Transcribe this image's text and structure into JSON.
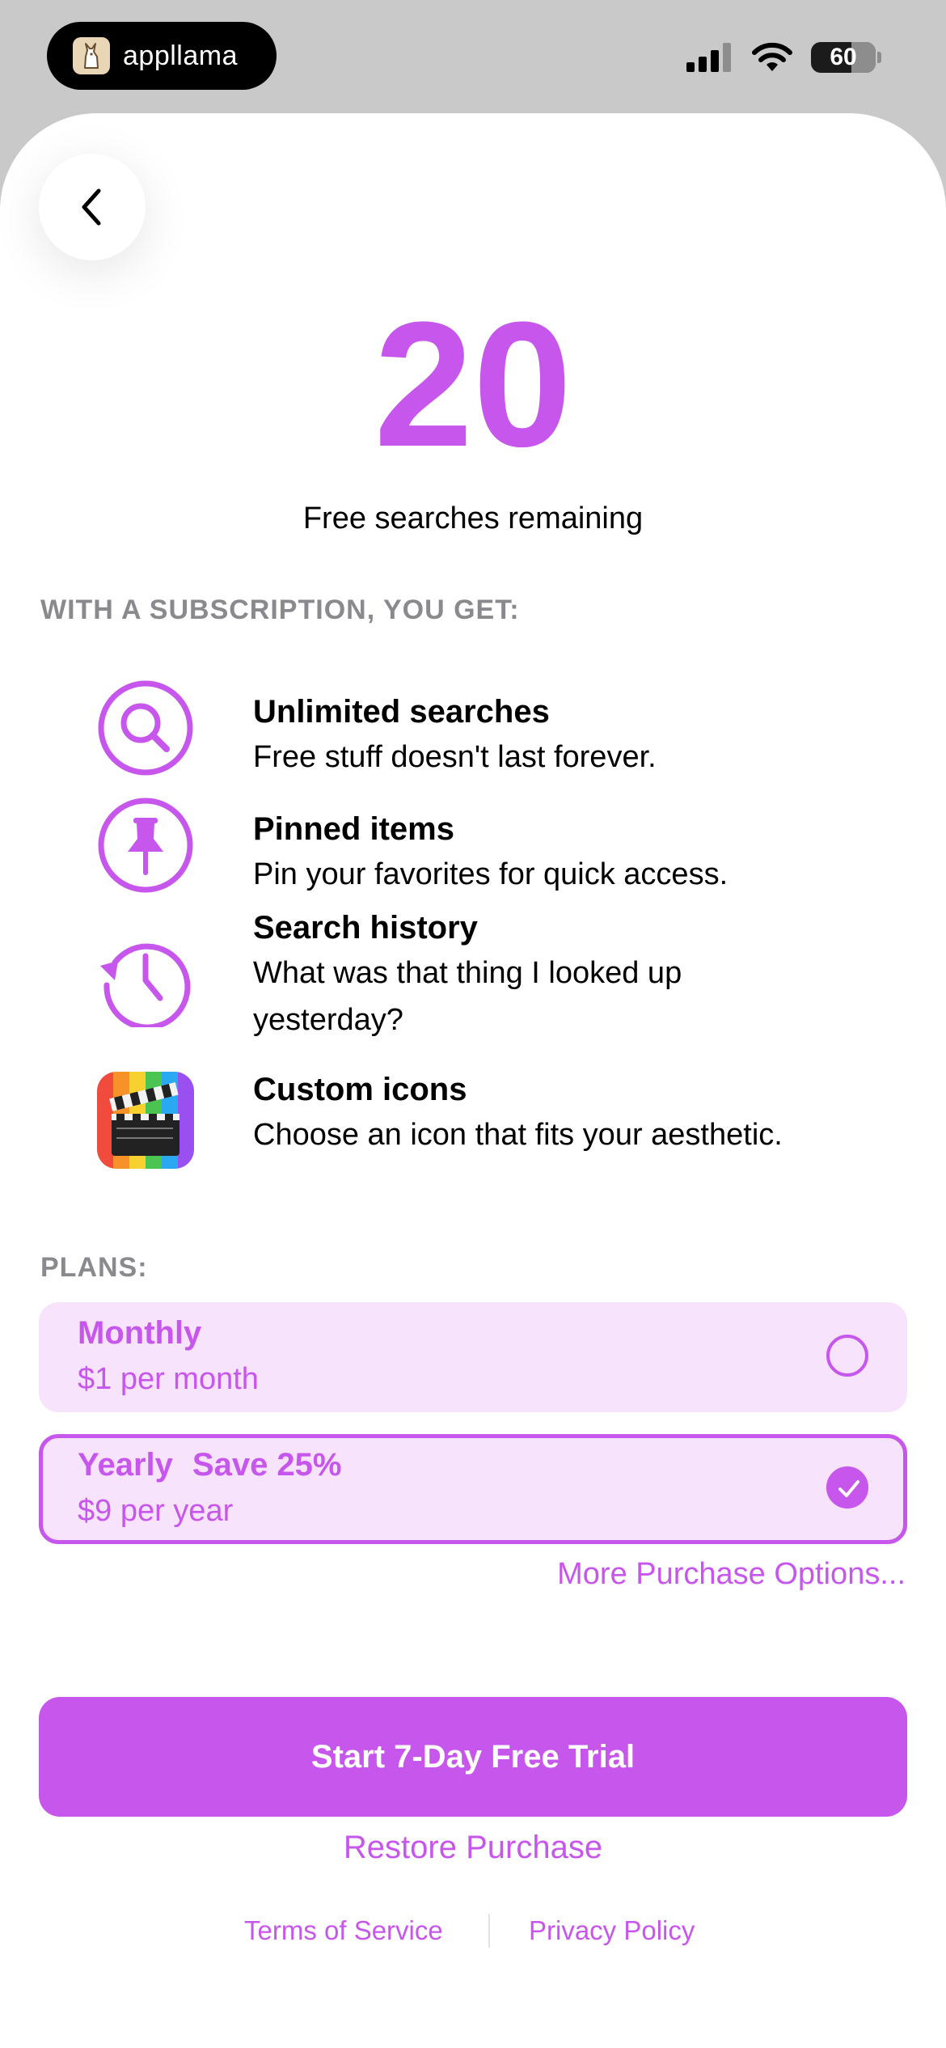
{
  "status_bar": {
    "brand_name": "appllama",
    "battery_level": "60"
  },
  "paywall": {
    "free_count": "20",
    "free_caption": "Free searches remaining",
    "benefits_header": "WITH A SUBSCRIPTION, YOU GET:",
    "features": [
      {
        "icon": "search-icon",
        "title": "Unlimited searches",
        "description": "Free stuff doesn't last forever."
      },
      {
        "icon": "pin-icon",
        "title": "Pinned items",
        "description": "Pin your favorites for quick access."
      },
      {
        "icon": "history-icon",
        "title": "Search history",
        "description": "What was that thing I looked up yesterday?"
      },
      {
        "icon": "custom-app-icon",
        "title": "Custom icons",
        "description": "Choose an icon that fits your aesthetic."
      }
    ],
    "plans_header": "PLANS:",
    "plans": [
      {
        "name": "Monthly",
        "save": "",
        "price": "$1 per month",
        "selected": false
      },
      {
        "name": "Yearly",
        "save": "Save 25%",
        "price": "$9 per year",
        "selected": true
      }
    ],
    "more_options": "More Purchase Options...",
    "cta_label": "Start 7-Day Free Trial",
    "restore_label": "Restore Purchase",
    "terms_label": "Terms of Service",
    "privacy_label": "Privacy Policy"
  },
  "colors": {
    "accent": "#c756ec",
    "plan_background": "#f7e4fc",
    "section_header": "#8a8a8e"
  }
}
